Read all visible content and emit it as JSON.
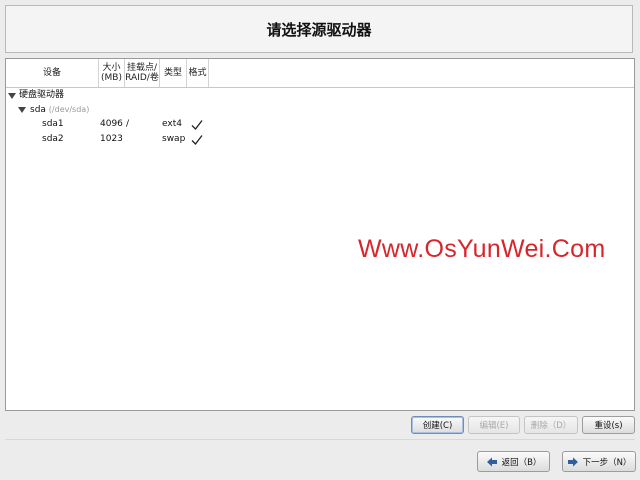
{
  "title": "请选择源驱动器",
  "table": {
    "headers": {
      "device": "设备",
      "size_line1": "大小",
      "size_line2": "(MB)",
      "mount_line1": "挂载点/",
      "mount_line2": "RAID/卷",
      "type": "类型",
      "format": "格式"
    },
    "group": "硬盘驱动器",
    "disk": {
      "name": "sda",
      "path": "(/dev/sda)"
    },
    "partitions": [
      {
        "name": "sda1",
        "size": "4096",
        "mount": "/",
        "type": "ext4",
        "format": true
      },
      {
        "name": "sda2",
        "size": "1023",
        "mount": "",
        "type": "swap",
        "format": true
      }
    ]
  },
  "actions": {
    "create": "创建(C)",
    "edit": "编辑(E)",
    "delete": "删除（D）",
    "reset": "重设(s)"
  },
  "nav": {
    "back": "返回（B）",
    "next": "下一步（N）"
  },
  "watermark": "Www.OsYunWei.Com",
  "colors": {
    "watermark": "#d8242a",
    "arrow": "#2f5f9e"
  }
}
